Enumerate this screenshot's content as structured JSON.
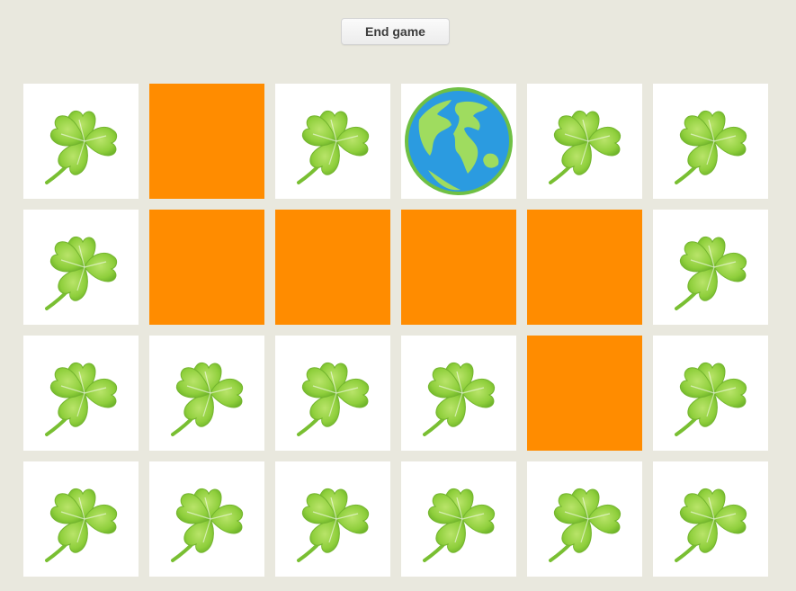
{
  "toolbar": {
    "end_label": "End game"
  },
  "colors": {
    "background": "#e9e8de",
    "card_back": "#ff8c00",
    "card_face": "#ffffff",
    "clover": "#8fcf3c",
    "globe_ocean": "#2b9be0",
    "globe_land": "#9fdc5f"
  },
  "board": {
    "rows": 4,
    "cols": 6,
    "cards": [
      "clover-icon",
      "hidden",
      "clover-icon",
      "globe-icon",
      "clover-icon",
      "clover-icon",
      "clover-icon",
      "hidden",
      "hidden",
      "hidden",
      "hidden",
      "clover-icon",
      "clover-icon",
      "clover-icon",
      "clover-icon",
      "clover-icon",
      "hidden",
      "clover-icon",
      "clover-icon",
      "clover-icon",
      "clover-icon",
      "clover-icon",
      "clover-icon",
      "clover-icon"
    ]
  }
}
